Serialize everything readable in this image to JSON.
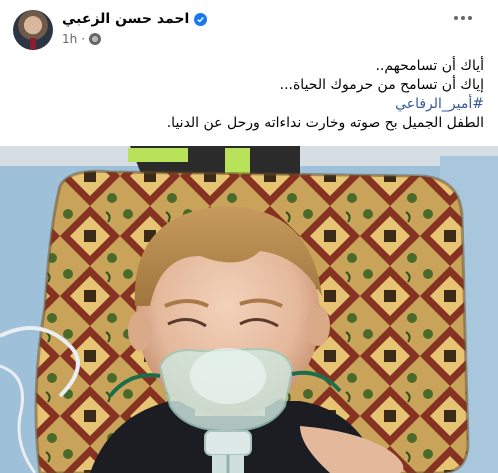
{
  "post": {
    "author": "احمد حسن الزعبي",
    "time": "1h",
    "privacy_icon": "globe-icon",
    "verified_icon": "verified-badge-icon",
    "more_icon": "more-options-icon",
    "text": {
      "line1": "أياك أن تسامحهم..",
      "line2": "إياك أن تسامح من حرموك الحياة...",
      "hashtag": "#أمير_الرفاعي",
      "line4": "الطفل الجميل بح صوته وخارت نداءاته ورحل عن الدنيا."
    }
  },
  "colors": {
    "brand": "#1877f2",
    "hashtag": "#385898",
    "meta": "#65676b"
  }
}
